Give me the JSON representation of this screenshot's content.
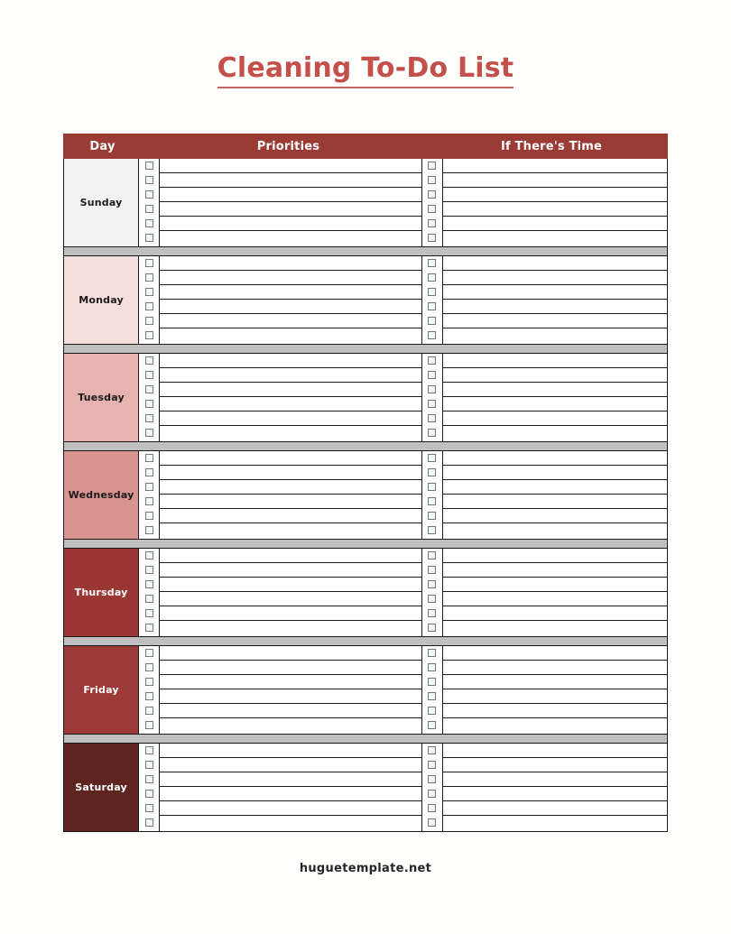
{
  "document": {
    "title": "Cleaning To-Do List",
    "title_color": "#c4504b",
    "footer": "huguetemplate.net",
    "background": "#fffffd"
  },
  "table": {
    "header_background": "#9a3b36",
    "header_text_color": "#ffffff",
    "separator_color": "#bfbfbf",
    "columns": [
      {
        "key": "day",
        "label": "Day"
      },
      {
        "key": "priorities",
        "label": "Priorities"
      },
      {
        "key": "extra",
        "label": "If There's Time"
      }
    ],
    "rows_per_day": 6,
    "checkbox_icon": "empty-checkbox",
    "days": [
      {
        "label": "Sunday",
        "fill": "#f2f2f2",
        "text_color": "#1a1a1a",
        "priorities": [
          "",
          "",
          "",
          "",
          "",
          ""
        ],
        "extra": [
          "",
          "",
          "",
          "",
          "",
          ""
        ]
      },
      {
        "label": "Monday",
        "fill": "#f6dedc",
        "text_color": "#1a1a1a",
        "priorities": [
          "",
          "",
          "",
          "",
          "",
          ""
        ],
        "extra": [
          "",
          "",
          "",
          "",
          "",
          ""
        ]
      },
      {
        "label": "Tuesday",
        "fill": "#e6b3b1",
        "text_color": "#1a1a1a",
        "priorities": [
          "",
          "",
          "",
          "",
          "",
          ""
        ],
        "extra": [
          "",
          "",
          "",
          "",
          "",
          ""
        ]
      },
      {
        "label": "Wednesday",
        "fill": "#d99490",
        "text_color": "#1a1a1a",
        "priorities": [
          "",
          "",
          "",
          "",
          "",
          ""
        ],
        "extra": [
          "",
          "",
          "",
          "",
          "",
          ""
        ]
      },
      {
        "label": "Thursday",
        "fill": "#9a3634",
        "text_color": "#ffffff",
        "priorities": [
          "",
          "",
          "",
          "",
          "",
          ""
        ],
        "extra": [
          "",
          "",
          "",
          "",
          "",
          ""
        ]
      },
      {
        "label": "Friday",
        "fill": "#9b3a36",
        "text_color": "#ffffff",
        "priorities": [
          "",
          "",
          "",
          "",
          "",
          ""
        ],
        "extra": [
          "",
          "",
          "",
          "",
          "",
          ""
        ]
      },
      {
        "label": "Saturday",
        "fill": "#5e2420",
        "text_color": "#ffffff",
        "priorities": [
          "",
          "",
          "",
          "",
          "",
          ""
        ],
        "extra": [
          "",
          "",
          "",
          "",
          "",
          ""
        ]
      }
    ]
  }
}
